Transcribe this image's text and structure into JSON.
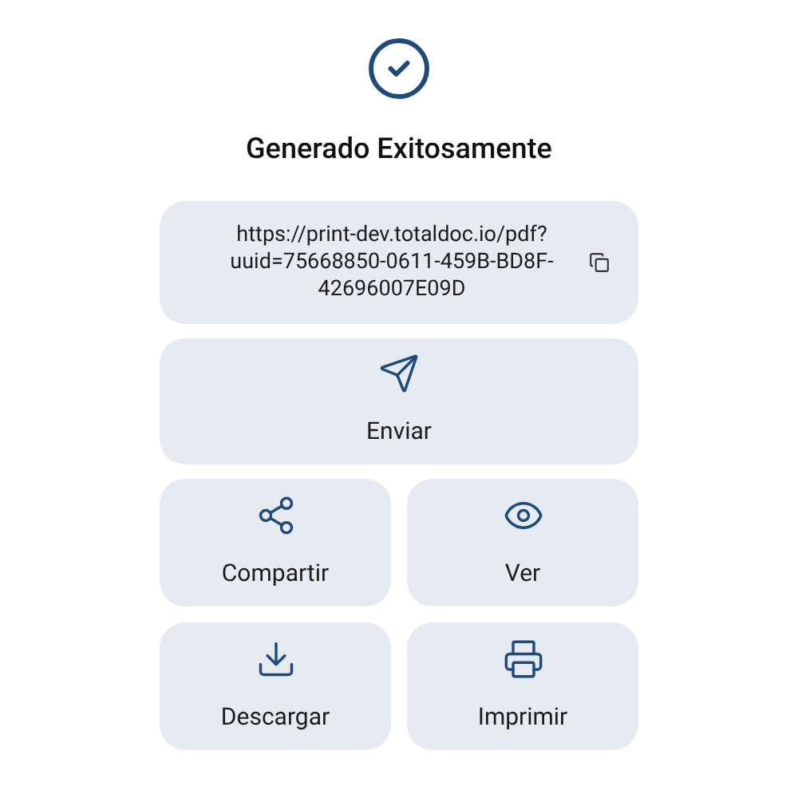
{
  "title": "Generado Exitosamente",
  "link": {
    "url": "https://print-dev.totaldoc.io/pdf?uuid=75668850-0611-459B-BD8F-42696007E09D"
  },
  "primary_action": {
    "kind": "send",
    "label": "Enviar"
  },
  "actions": [
    {
      "kind": "share",
      "label": "Compartir"
    },
    {
      "kind": "view",
      "label": "Ver"
    },
    {
      "kind": "download",
      "label": "Descargar"
    },
    {
      "kind": "print",
      "label": "Imprimir"
    }
  ]
}
